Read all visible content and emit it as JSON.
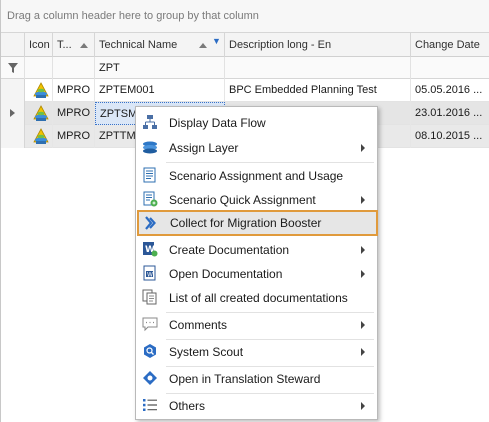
{
  "group_panel": {
    "text": "Drag a column header here to group by that column"
  },
  "columns": {
    "icon": "Icon",
    "type": "T...",
    "technical_name": "Technical Name",
    "description": "Description long - En",
    "change_date": "Change Date"
  },
  "filter": {
    "technical_name": "ZPT"
  },
  "rows": [
    {
      "type": "MPRO",
      "technical_name": "ZPTEM001",
      "description": "BPC Embedded Planning Test",
      "change_date": "05.05.2016 ..."
    },
    {
      "type": "MPRO",
      "technical_name": "ZPTSM1",
      "description": "",
      "change_date": "23.01.2016 ..."
    },
    {
      "type": "MPRO",
      "technical_name": "ZPTTM1",
      "description": "",
      "change_date": "08.10.2015 ..."
    }
  ],
  "menu": {
    "items": [
      {
        "label": "Display Data Flow",
        "icon": "data-flow-icon",
        "submenu": false
      },
      {
        "label": "Assign Layer",
        "icon": "layer-icon",
        "submenu": true
      },
      {
        "label": "Scenario Assignment and Usage",
        "icon": "scenario-doc-icon",
        "submenu": false
      },
      {
        "label": "Scenario Quick Assignment",
        "icon": "quick-assign-icon",
        "submenu": true
      },
      {
        "label": "Collect for Migration Booster",
        "icon": "migration-booster-icon",
        "submenu": false
      },
      {
        "label": "Create Documentation",
        "icon": "create-doc-icon",
        "submenu": true
      },
      {
        "label": "Open Documentation",
        "icon": "open-doc-icon",
        "submenu": true
      },
      {
        "label": "List of all created documentations",
        "icon": "doc-list-icon",
        "submenu": false
      },
      {
        "label": "Comments",
        "icon": "comment-icon",
        "submenu": true
      },
      {
        "label": "System Scout",
        "icon": "system-scout-icon",
        "submenu": true
      },
      {
        "label": "Open in Translation Steward",
        "icon": "translation-icon",
        "submenu": false
      },
      {
        "label": "Others",
        "icon": "list-icon",
        "submenu": true
      }
    ]
  },
  "colors": {
    "highlight_border": "#e09a3c",
    "accent_blue": "#2b6cc4"
  }
}
